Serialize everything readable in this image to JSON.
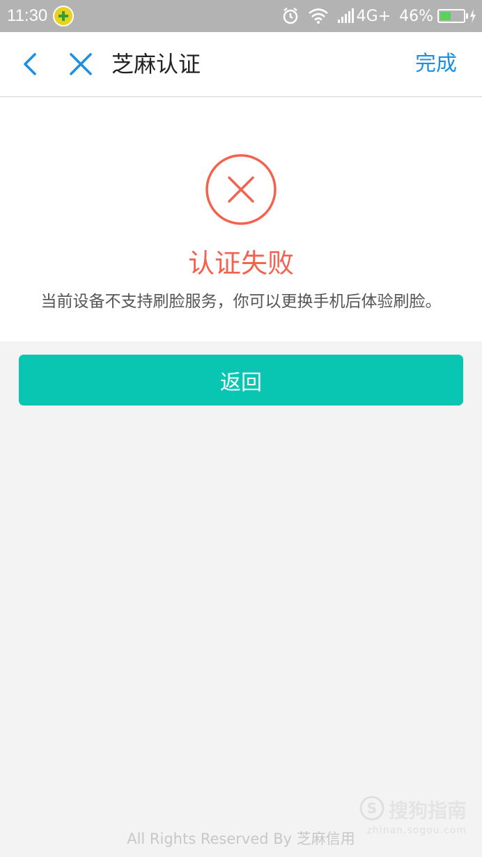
{
  "status_bar": {
    "time": "11:30",
    "network": "4G+",
    "battery": "46%",
    "battery_level": 0.46
  },
  "nav": {
    "title": "芝麻认证",
    "done_label": "完成"
  },
  "result": {
    "title": "认证失败",
    "description": "当前设备不支持刷脸服务，你可以更换手机后体验刷脸。"
  },
  "button": {
    "return_label": "返回"
  },
  "footer": {
    "text": "All Rights Reserved By 芝麻信用"
  },
  "watermark": {
    "brand": "搜狗指南",
    "url": "zhinan.sogou.com"
  },
  "colors": {
    "accent": "#08c6b2",
    "error": "#f5614f",
    "link": "#1b8fe3"
  }
}
